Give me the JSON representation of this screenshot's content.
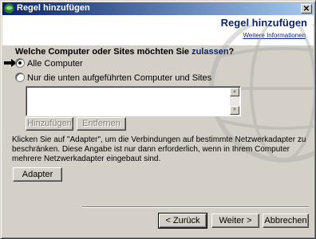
{
  "window": {
    "title": "Regel hinzufügen"
  },
  "header": {
    "title": "Regel hinzufügen",
    "more_info": "Weitere Informationen"
  },
  "question": {
    "prefix": "Welche Computer oder Sites möchten Sie ",
    "accent": "zulassen",
    "suffix": "?"
  },
  "options": [
    {
      "label": "Alle Computer",
      "selected": true
    },
    {
      "label": "Nur die unten aufgeführten Computer und Sites",
      "selected": false
    }
  ],
  "buttons": {
    "add": "Hinzufügen",
    "remove": "Entfernen",
    "adapter": "Adapter",
    "back": "< Zurück",
    "next": "Weiter >",
    "cancel": "Abbrechen"
  },
  "info_text": "Klicken Sie auf \"Adapter\", um die Verbindungen auf bestimmte Netzwerkadapter zu beschränken. Diese Angabe ist nur dann erforderlich, wenn in Ihrem Computer mehrere Netzwerkadapter eingebaut sind.",
  "icons": {
    "title": "firewall-app-icon",
    "arrow": "pointer-arrow-icon",
    "close": "close-icon",
    "scroll_up": "scroll-up-icon",
    "scroll_down": "scroll-down-icon"
  },
  "colors": {
    "accent": "#0a246a",
    "title_gradient_start": "#0a246a",
    "title_gradient_end": "#a6caf0",
    "face": "#d4d0c8"
  }
}
